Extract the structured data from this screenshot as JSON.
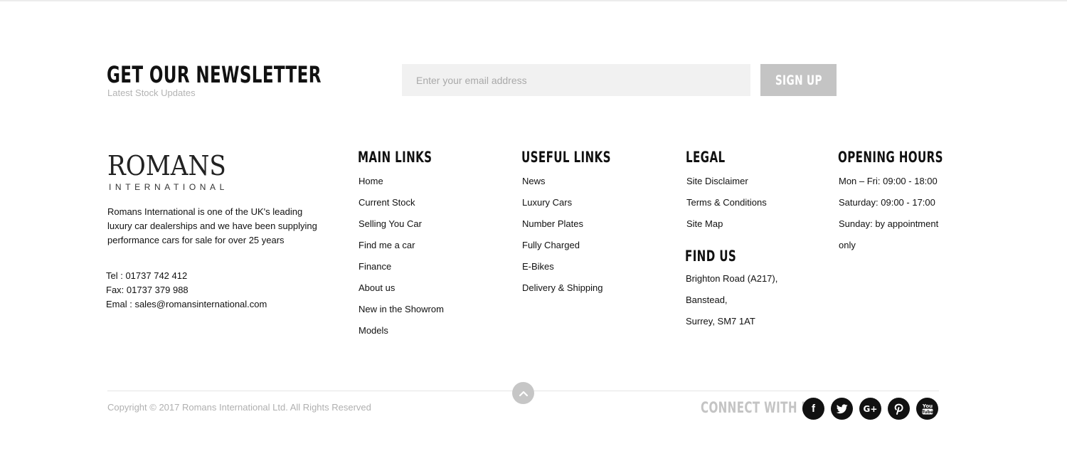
{
  "newsletter": {
    "title": "GET OUR NEWSLETTER",
    "subtitle": "Latest Stock Updates",
    "email_placeholder": "Enter your email address",
    "signup_label": "SIGN UP"
  },
  "brand": {
    "logo_main": "ROMANS",
    "logo_sub": "INTERNATIONAL",
    "about": "Romans International is one of the UK's leading luxury car dealerships and we have been supplying performance cars for sale for over 25 years",
    "tel": "Tel : 01737 742 412",
    "fax": "Fax: 01737 379 988",
    "email": "Emal : sales@romansinternational.com"
  },
  "main_links": {
    "title": "MAIN LINKS",
    "items": [
      "Home",
      "Current Stock",
      "Selling You Car",
      "Find me a car",
      "Finance",
      "About us",
      "New in the Showrom",
      "Models"
    ]
  },
  "useful_links": {
    "title": "USEFUL LINKS",
    "items": [
      "News",
      "Luxury Cars",
      "Number Plates",
      "Fully Charged",
      "E-Bikes",
      "Delivery & Shipping"
    ]
  },
  "legal": {
    "title": "LEGAL",
    "items": [
      "Site Disclaimer",
      "Terms & Conditions",
      "Site Map"
    ]
  },
  "find_us": {
    "title": "FIND US",
    "lines": [
      "Brighton Road (A217),",
      "Banstead,",
      "Surrey, SM7 1AT"
    ]
  },
  "opening_hours": {
    "title": "OPENING HOURS",
    "lines": [
      "Mon – Fri: 09:00 - 18:00",
      "Saturday: 09:00 - 17:00",
      "Sunday: by appointment",
      "only"
    ]
  },
  "footer": {
    "copyright": "Copyright © 2017 Romans International Ltd. All Rights Reserved",
    "connect_label": "CONNECT WITH US",
    "social": [
      {
        "name": "facebook-icon",
        "glyph": "f"
      },
      {
        "name": "twitter-icon",
        "glyph": "t"
      },
      {
        "name": "google-plus-icon",
        "glyph": "G+"
      },
      {
        "name": "pinterest-icon",
        "glyph": "P"
      },
      {
        "name": "youtube-icon",
        "glyph": "You Tube"
      }
    ]
  },
  "colors": {
    "input_bg": "#f1f1f1",
    "button_bg": "#c4c4c4",
    "muted_text": "#b0b0b0",
    "social_bg": "#111111"
  }
}
